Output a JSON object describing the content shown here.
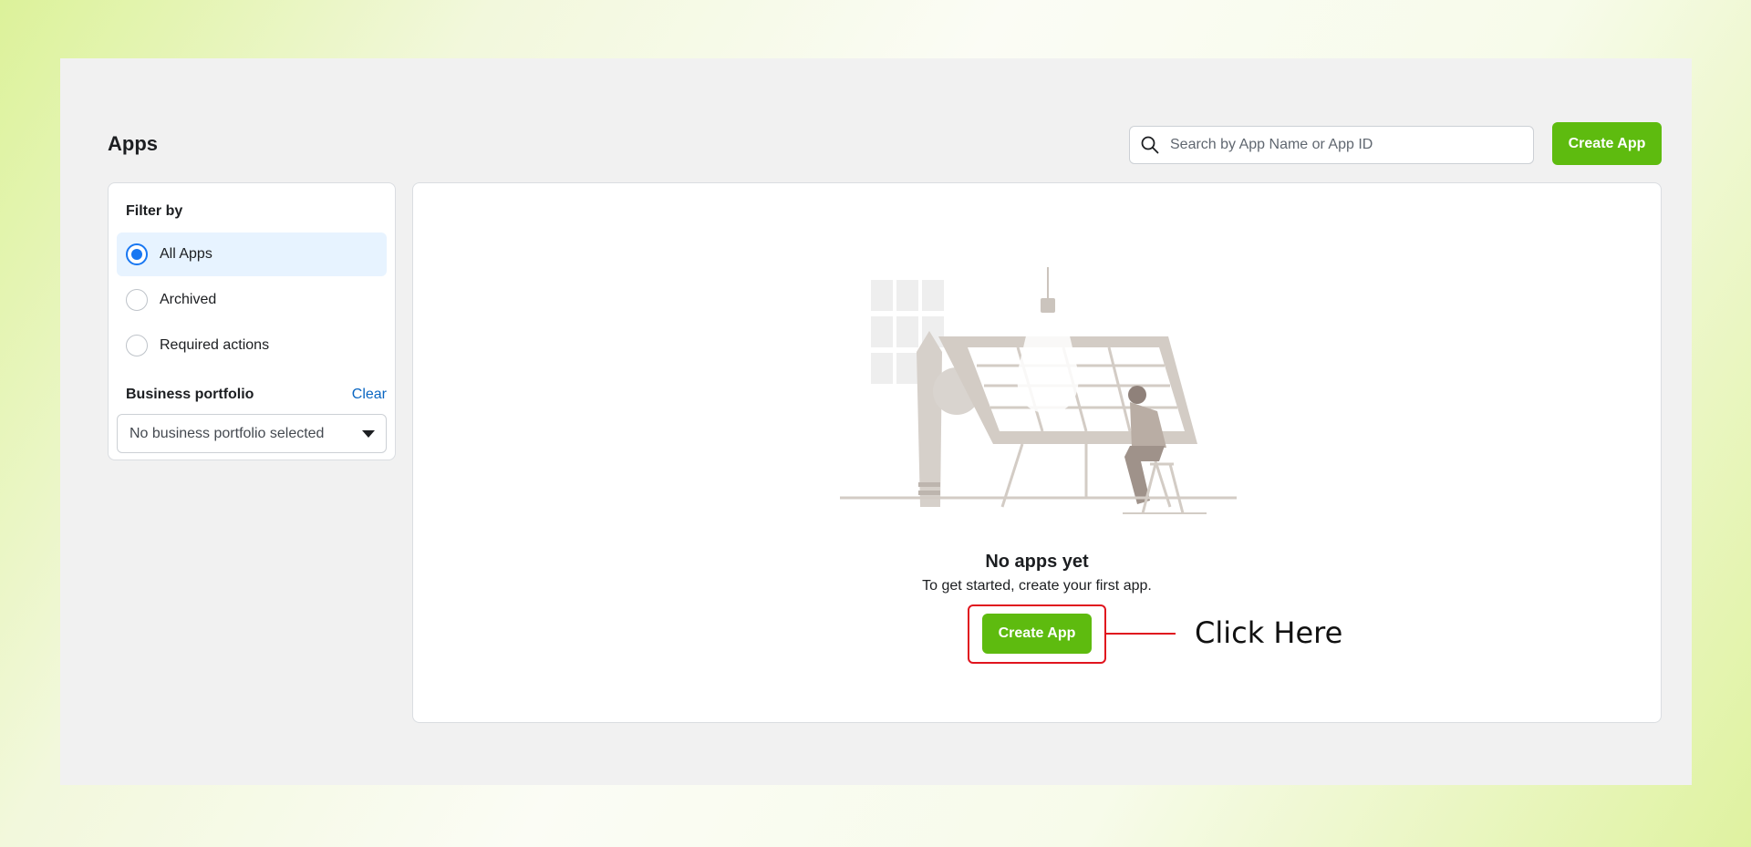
{
  "page": {
    "title": "Apps"
  },
  "search": {
    "placeholder": "Search by App Name or App ID",
    "icon": "search-icon"
  },
  "header": {
    "create_app_label": "Create App"
  },
  "filter": {
    "title": "Filter by",
    "options": [
      {
        "label": "All Apps",
        "selected": true
      },
      {
        "label": "Archived",
        "selected": false
      },
      {
        "label": "Required actions",
        "selected": false
      }
    ],
    "business_portfolio": {
      "title": "Business portfolio",
      "clear_label": "Clear",
      "selected_value": "No business portfolio selected"
    }
  },
  "empty_state": {
    "title": "No apps yet",
    "subtitle": "To get started, create your first app.",
    "create_app_label": "Create App",
    "illustration": "person-drawing-lightbulb-illustration"
  },
  "annotation": {
    "label": "Click Here"
  },
  "colors": {
    "primary_green": "#5ebb0f",
    "link_blue": "#0a66c2",
    "selected_bg": "#e7f3ff",
    "radio_blue": "#1877f2",
    "annotation_red": "#e0141e"
  }
}
